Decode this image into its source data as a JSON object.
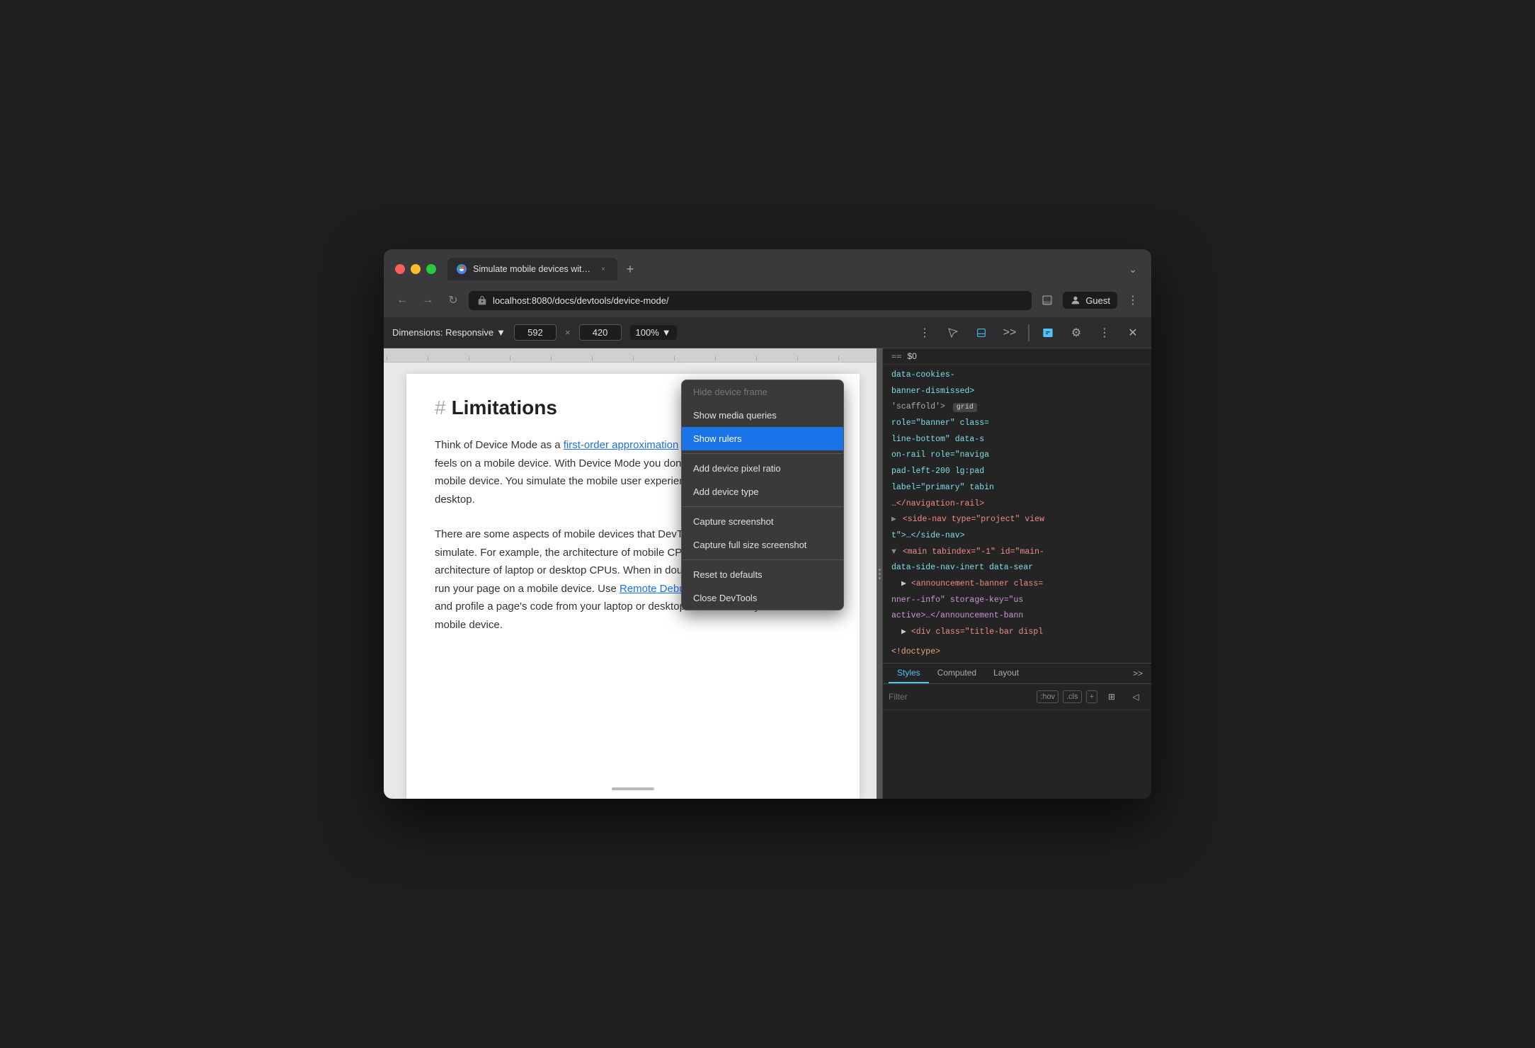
{
  "window": {
    "title": "Simulate mobile devices with D"
  },
  "trafficLights": {
    "red": "#ff5f57",
    "yellow": "#ffbd2e",
    "green": "#28c840"
  },
  "tab": {
    "title": "Simulate mobile devices with D",
    "url": "localhost:8080/docs/devtools/device-mode/",
    "closeLabel": "×"
  },
  "addressBar": {
    "back": "←",
    "forward": "→",
    "reload": "↻",
    "url": "localhost:8080/docs/devtools/device-mode/",
    "profileLabel": "Guest",
    "moreLabel": "⋮"
  },
  "deviceToolbar": {
    "dimensionsLabel": "Dimensions: Responsive",
    "dimensionsArrow": "▼",
    "width": "592",
    "height": "420",
    "separator": "×",
    "zoom": "100%",
    "zoomArrow": "▼",
    "moreLabel": "⋮"
  },
  "pageContent": {
    "heading": "Limitations",
    "hashSymbol": "#",
    "para1": "Think of Device Mode as a first-order approximation of how your page looks and feels on a mobile device. With Device Mode you don't actually run your code on a mobile device. You simulate the mobile user experience from your laptop or desktop.",
    "link1": "first-order approximation",
    "para2": "There are some aspects of mobile devices that DevTools will never be able to simulate. For example, the architecture of mobile CPUs is very different than the architecture of laptop or desktop CPUs. When in doubt, your best bet is to actually run your page on a mobile device. Use Remote Debugging to view, change, debug, and profile a page's code from your laptop or desktop while it actually runs on a mobile device.",
    "link2": "Remote Debugging"
  },
  "contextMenu": {
    "items": [
      {
        "id": "hide-device-frame",
        "label": "Hide device frame",
        "active": false,
        "disabled": true
      },
      {
        "id": "show-media-queries",
        "label": "Show media queries",
        "active": false,
        "disabled": false
      },
      {
        "id": "show-rulers",
        "label": "Show rulers",
        "active": true,
        "disabled": false
      },
      {
        "id": "sep1",
        "type": "separator"
      },
      {
        "id": "add-device-pixel-ratio",
        "label": "Add device pixel ratio",
        "active": false,
        "disabled": false
      },
      {
        "id": "add-device-type",
        "label": "Add device type",
        "active": false,
        "disabled": false
      },
      {
        "id": "sep2",
        "type": "separator"
      },
      {
        "id": "capture-screenshot",
        "label": "Capture screenshot",
        "active": false,
        "disabled": false
      },
      {
        "id": "capture-full-size",
        "label": "Capture full size screenshot",
        "active": false,
        "disabled": false
      },
      {
        "id": "sep3",
        "type": "separator"
      },
      {
        "id": "reset-to-defaults",
        "label": "Reset to defaults",
        "active": false,
        "disabled": false
      },
      {
        "id": "close-devtools",
        "label": "Close DevTools",
        "active": false,
        "disabled": false
      }
    ]
  },
  "devtools": {
    "dollarSign": "==",
    "selectedEl": "$0",
    "domLines": [
      {
        "content": "data-cookies-banner-dismissed>"
      },
      {
        "content": "▶ <side-nav type=\"project\" view-t>…</side-nav>"
      },
      {
        "content": "▼ <main tabindex=\"-1\" id=\"main-data-side-nav-inert data-sear"
      },
      {
        "content": "  ▶ <announcement-banner class=nner--info\" storage-key=\"usactive>…</announcement-bann"
      },
      {
        "content": "  ▶ <div class=\"title-bar displ"
      },
      {
        "content": "<!doctype>"
      }
    ],
    "scaffoldBadge": "grid",
    "scaffoldText": "'scaffold'>",
    "roleText": "role=\"banner\" class=",
    "classText": "line-bottom\" data-s",
    "navText": "on-rail role=\"naviga",
    "padText": "pad-left-200 lg:pad",
    "labelText": "label=\"primary\" tabin",
    "navClosing": "…</navigation-rail>",
    "stylesTabs": [
      "Styles",
      "Computed",
      "Layout"
    ],
    "filterPlaceholder": "Filter",
    "hovLabel": ":hov",
    "clsLabel": ".cls",
    "plusLabel": "+"
  }
}
